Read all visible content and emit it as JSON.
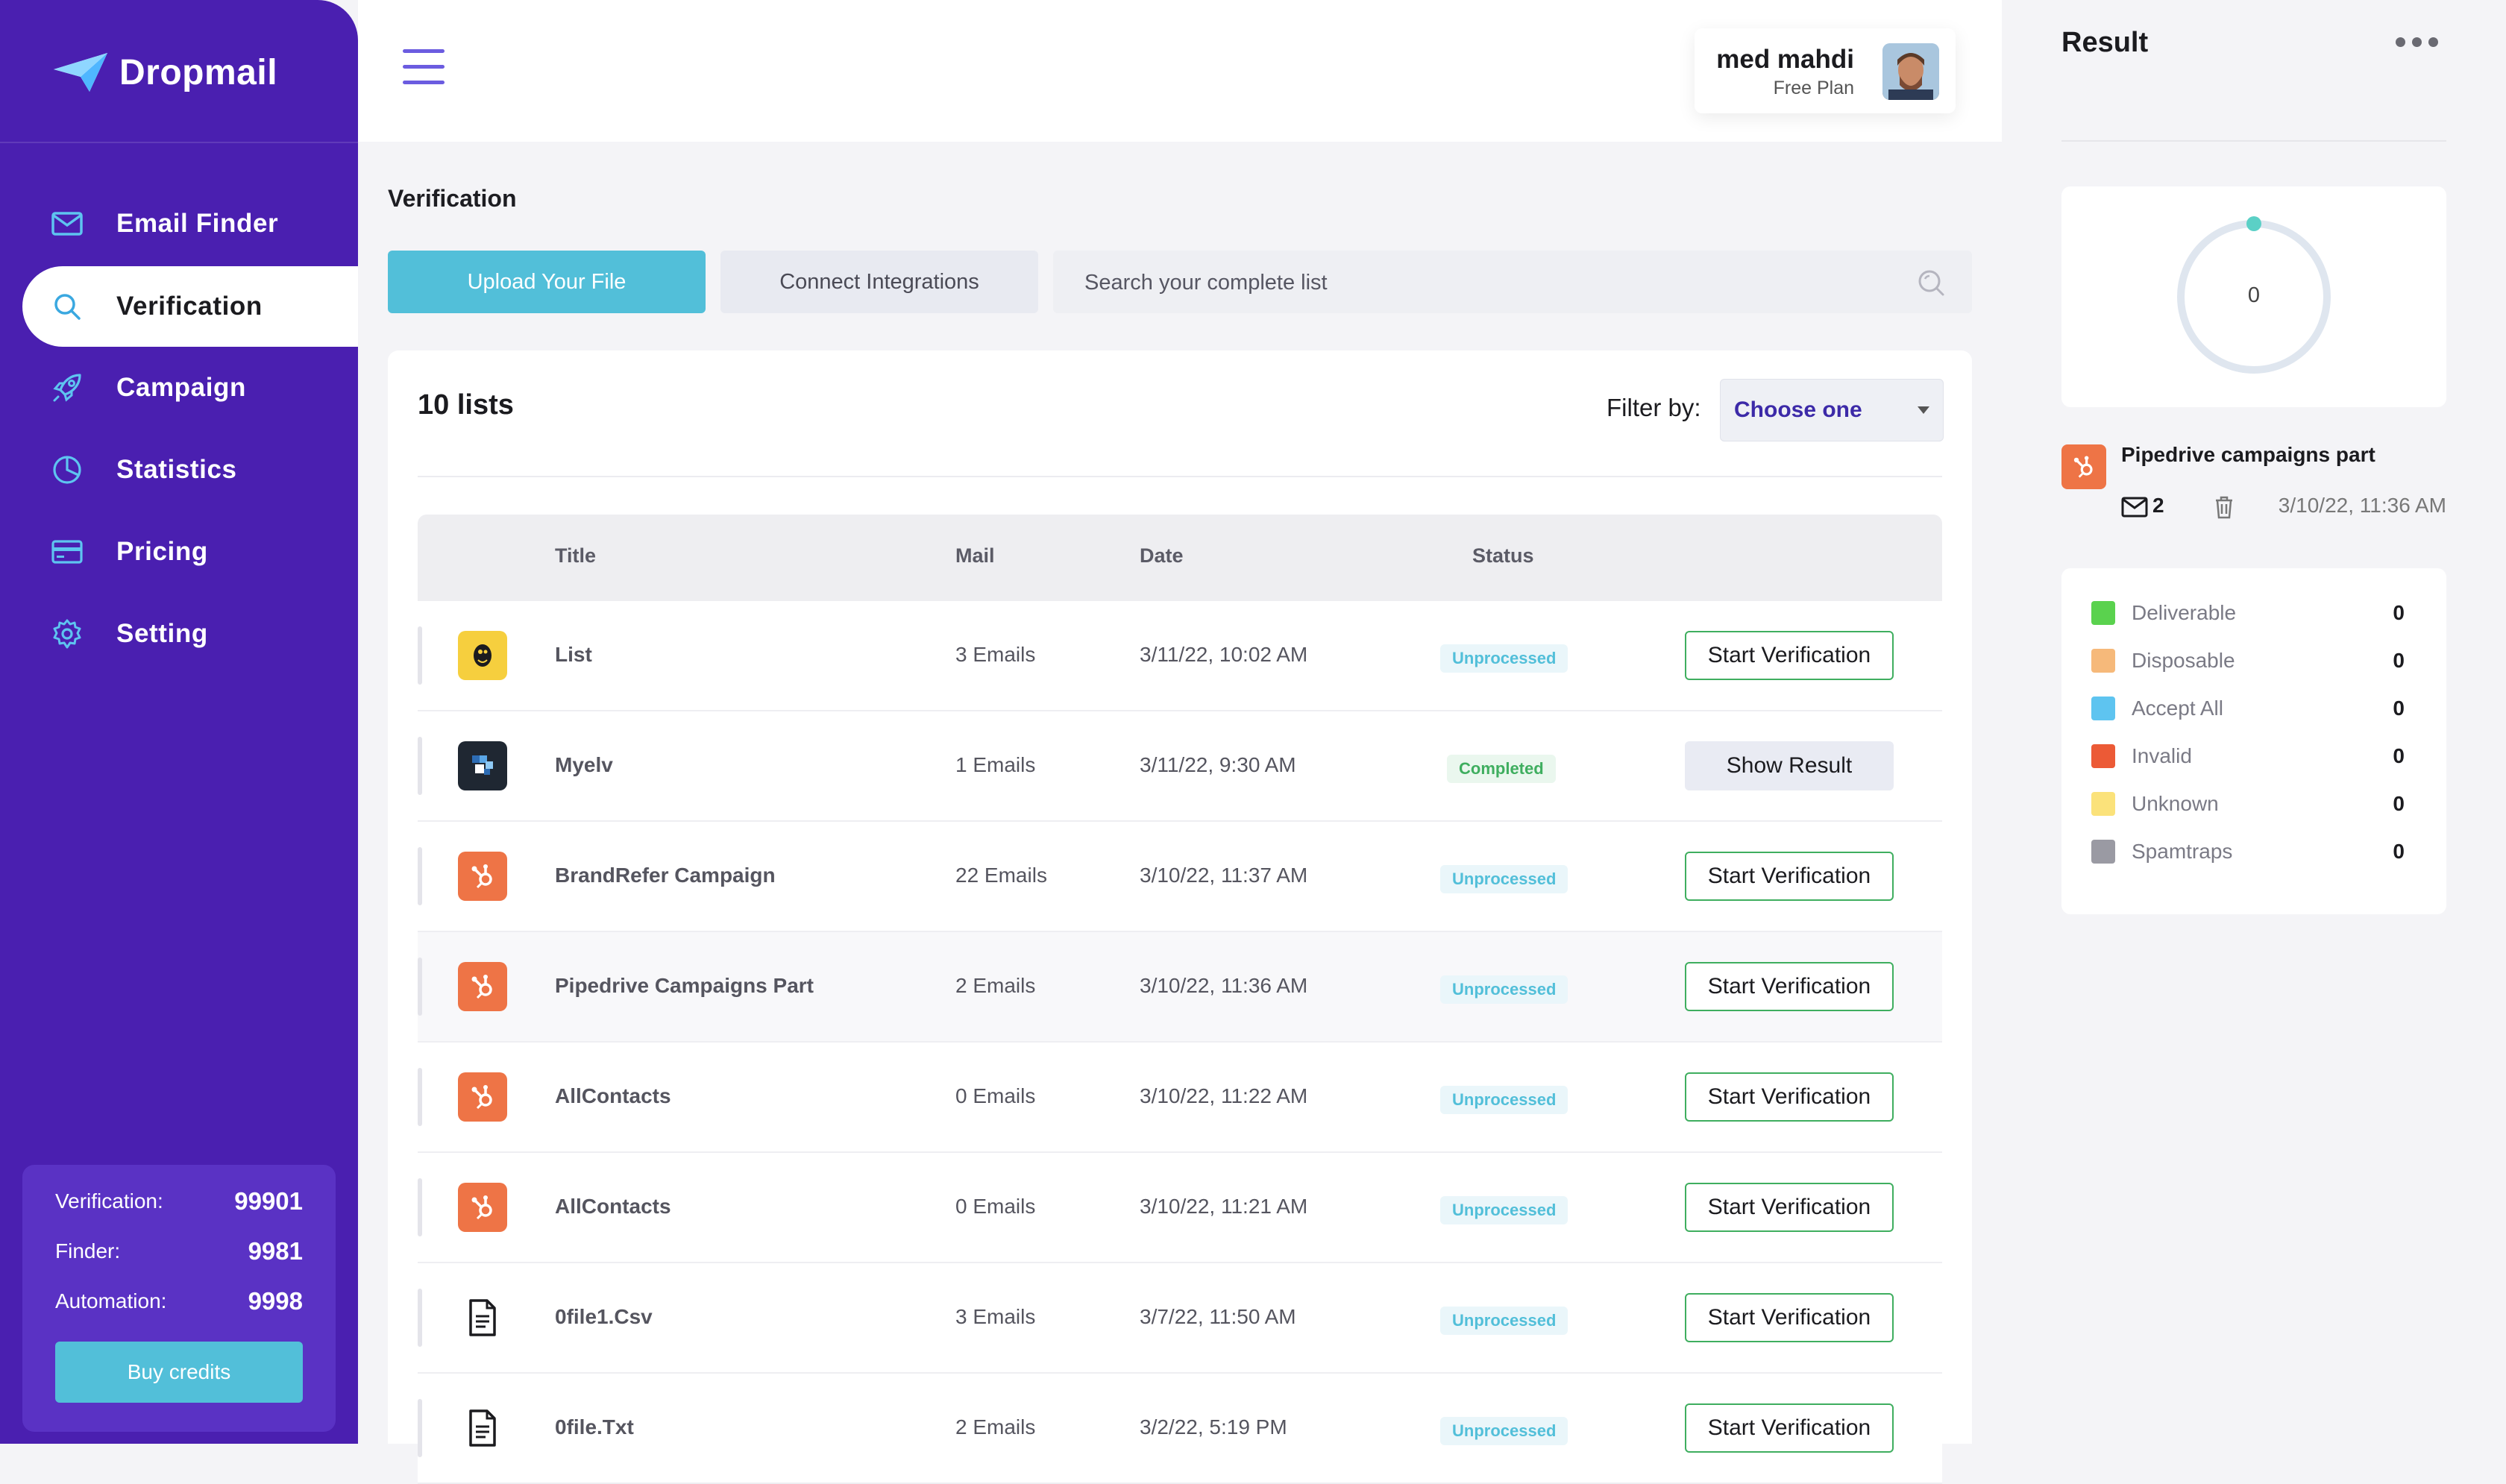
{
  "app": {
    "name": "Dropmail"
  },
  "sidebar": {
    "items": [
      {
        "label": "Email Finder",
        "icon": "mail-icon",
        "active": false
      },
      {
        "label": "Verification",
        "icon": "search-icon",
        "active": true
      },
      {
        "label": "Campaign",
        "icon": "rocket-icon",
        "active": false
      },
      {
        "label": "Statistics",
        "icon": "pie-chart-icon",
        "active": false
      },
      {
        "label": "Pricing",
        "icon": "credit-card-icon",
        "active": false
      },
      {
        "label": "Setting",
        "icon": "gear-icon",
        "active": false
      }
    ],
    "credits": {
      "verification_label": "Verification:",
      "verification_value": "99901",
      "finder_label": "Finder:",
      "finder_value": "9981",
      "automation_label": "Automation:",
      "automation_value": "9998",
      "buy_label": "Buy credits"
    }
  },
  "user": {
    "name": "med mahdi",
    "plan": "Free Plan"
  },
  "main": {
    "title": "Verification",
    "upload_label": "Upload Your File",
    "connect_label": "Connect Integrations",
    "search_placeholder": "Search your complete list",
    "list_count": "10 lists",
    "filter_label": "Filter by:",
    "filter_value": "Choose one",
    "columns": {
      "title": "Title",
      "mail": "Mail",
      "date": "Date",
      "status": "Status"
    },
    "rows": [
      {
        "logo": "mailchimp-icon",
        "title": "List",
        "mail": "3 Emails",
        "date": "3/11/22, 10:02 AM",
        "status": "Unprocessed",
        "action": "Start Verification"
      },
      {
        "logo": "myelv-icon",
        "title": "Myelv",
        "mail": "1 Emails",
        "date": "3/11/22, 9:30 AM",
        "status": "Completed",
        "action": "Show Result"
      },
      {
        "logo": "hubspot-icon",
        "title": "BrandRefer Campaign",
        "mail": "22 Emails",
        "date": "3/10/22, 11:37 AM",
        "status": "Unprocessed",
        "action": "Start Verification"
      },
      {
        "logo": "hubspot-icon",
        "title": "Pipedrive Campaigns Part",
        "mail": "2 Emails",
        "date": "3/10/22, 11:36 AM",
        "status": "Unprocessed",
        "action": "Start Verification"
      },
      {
        "logo": "hubspot-icon",
        "title": "AllContacts",
        "mail": "0 Emails",
        "date": "3/10/22, 11:22 AM",
        "status": "Unprocessed",
        "action": "Start Verification"
      },
      {
        "logo": "hubspot-icon",
        "title": "AllContacts",
        "mail": "0 Emails",
        "date": "3/10/22, 11:21 AM",
        "status": "Unprocessed",
        "action": "Start Verification"
      },
      {
        "logo": "file-icon",
        "title": "0file1.Csv",
        "mail": "3 Emails",
        "date": "3/7/22, 11:50 AM",
        "status": "Unprocessed",
        "action": "Start Verification"
      },
      {
        "logo": "file-icon",
        "title": "0file.Txt",
        "mail": "2 Emails",
        "date": "3/2/22, 5:19 PM",
        "status": "Unprocessed",
        "action": "Start Verification"
      }
    ]
  },
  "result": {
    "title": "Result",
    "donut_value": "0",
    "campaign_name": "Pipedrive campaigns part",
    "campaign_count": "2",
    "campaign_date": "3/10/22, 11:36 AM",
    "legend": [
      {
        "label": "Deliverable",
        "value": "0",
        "color": "#5ad24e"
      },
      {
        "label": "Disposable",
        "value": "0",
        "color": "#f6b97a"
      },
      {
        "label": "Accept All",
        "value": "0",
        "color": "#5ec4f0"
      },
      {
        "label": "Invalid",
        "value": "0",
        "color": "#ec5a36"
      },
      {
        "label": "Unknown",
        "value": "0",
        "color": "#fbe27a"
      },
      {
        "label": "Spamtraps",
        "value": "0",
        "color": "#9a9aa3"
      }
    ]
  },
  "colors": {
    "sidebar": "#4a1fb0",
    "accent": "#52bfd9",
    "success": "#3fae5f",
    "hubspot": "#ee7446"
  }
}
